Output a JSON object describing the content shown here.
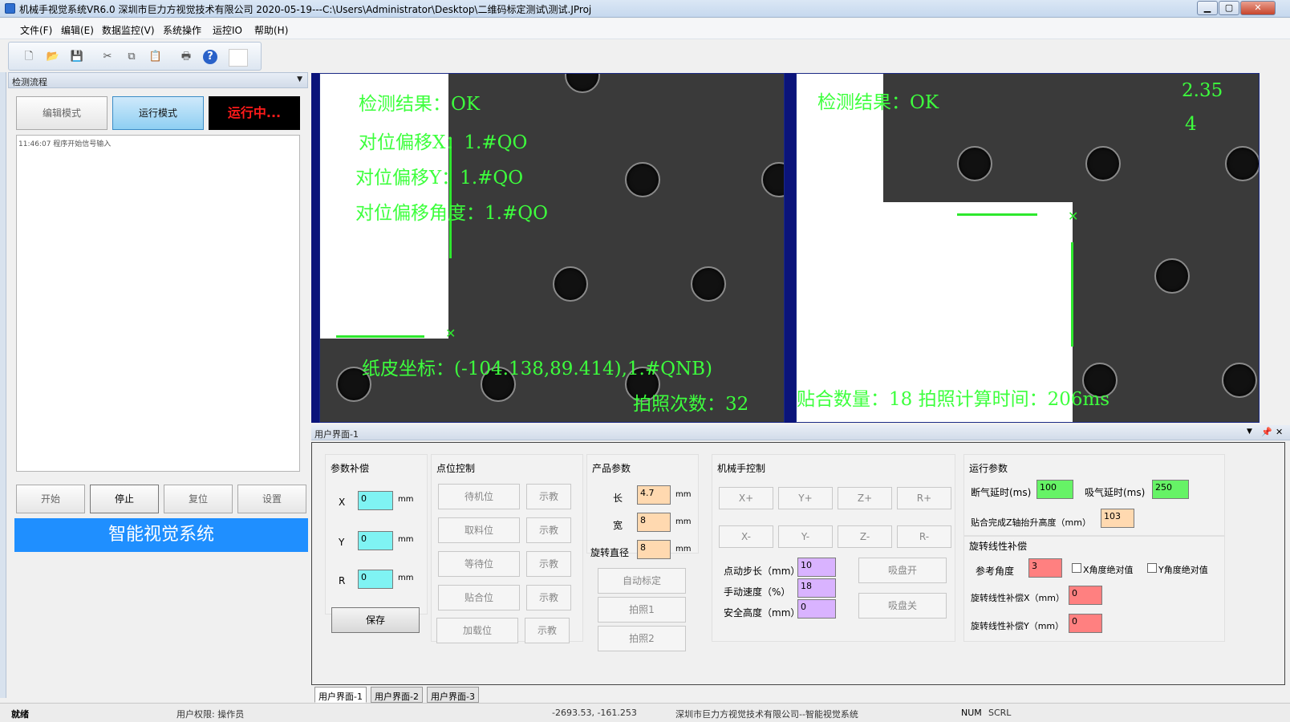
{
  "window": {
    "title": "机械手视觉系统VR6.0  深圳市巨力方视觉技术有限公司  2020-05-19---C:\\Users\\Administrator\\Desktop\\二维码标定测试\\测试.JProj",
    "min": "▁",
    "max": "▢",
    "close": "✕"
  },
  "menu": [
    "文件(F)",
    "编辑(E)",
    "数据监控(V)",
    "系统操作",
    "运控IO",
    "帮助(H)"
  ],
  "left": {
    "header": "检测流程",
    "edit_mode": "编辑模式",
    "run_mode": "运行模式",
    "running": "运行中...",
    "log": "11:46:07  程序开始信号输入",
    "start": "开始",
    "stop": "停止",
    "reset": "复位",
    "settings": "设置",
    "banner": "智能视觉系统"
  },
  "cam1": {
    "result": "检测结果：OK",
    "offset_x": "对位偏移X：1.#QO",
    "offset_y": "对位偏移Y：1.#QO",
    "offset_angle": "对位偏移角度：1.#QO",
    "paper_coord": "纸皮坐标：(-104.138,89.414),1.#QNB)",
    "shot_count": "拍照次数：32"
  },
  "cam2": {
    "result": "检测结果：OK",
    "value1": "2.35",
    "value2": "4",
    "bottom": "贴合数量：18  拍照计算时间：206ms"
  },
  "ui": {
    "header": "用户界面-1",
    "param_comp": {
      "title": "参数补偿",
      "x_label": "X",
      "y_label": "Y",
      "r_label": "R",
      "x": "0",
      "y": "0",
      "r": "0",
      "unit": "mm",
      "save": "保存"
    },
    "point_ctrl": {
      "title": "点位控制",
      "points": [
        "待机位",
        "取料位",
        "等待位",
        "贴合位",
        "加载位"
      ],
      "teach": "示教"
    },
    "product": {
      "title": "产品参数",
      "length_label": "长",
      "width_label": "宽",
      "dia_label": "旋转直径",
      "length": "4.7",
      "width": "8",
      "dia": "8",
      "unit": "mm",
      "auto_calib": "自动标定",
      "photo1": "拍照1",
      "photo2": "拍照2"
    },
    "robot": {
      "title": "机械手控制",
      "plus": [
        "X+",
        "Y+",
        "Z+",
        "R+"
      ],
      "minus": [
        "X-",
        "Y-",
        "Z-",
        "R-"
      ],
      "step_label": "点动步长（mm）",
      "speed_label": "手动速度（%）",
      "safe_label": "安全高度（mm）",
      "step": "10",
      "speed": "18",
      "safe": "0",
      "suction_on": "吸盘开",
      "suction_off": "吸盘关"
    },
    "run": {
      "title": "运行参数",
      "break_label": "断气延时(ms)",
      "break": "100",
      "suck_label": "吸气延时(ms)",
      "suck": "250",
      "lift_label": "贴合完成Z轴抬升高度（mm）",
      "lift": "103"
    },
    "rot": {
      "title": "旋转线性补偿",
      "ref_label": "参考角度",
      "ref": "3",
      "x_abs": "X角度绝对值",
      "y_abs": "Y角度绝对值",
      "comp_x_label": "旋转线性补偿X（mm）",
      "comp_x": "0",
      "comp_y_label": "旋转线性补偿Y（mm）",
      "comp_y": "0"
    }
  },
  "tabs": [
    "用户界面-1",
    "用户界面-2",
    "用户界面-3"
  ],
  "status": {
    "ready": "就绪",
    "perm": "用户权限: 操作员",
    "coord": "-2693.53, -161.253",
    "company": "深圳市巨力方视觉技术有限公司--智能视觉系统",
    "num": "NUM",
    "scrl": "SCRL"
  }
}
